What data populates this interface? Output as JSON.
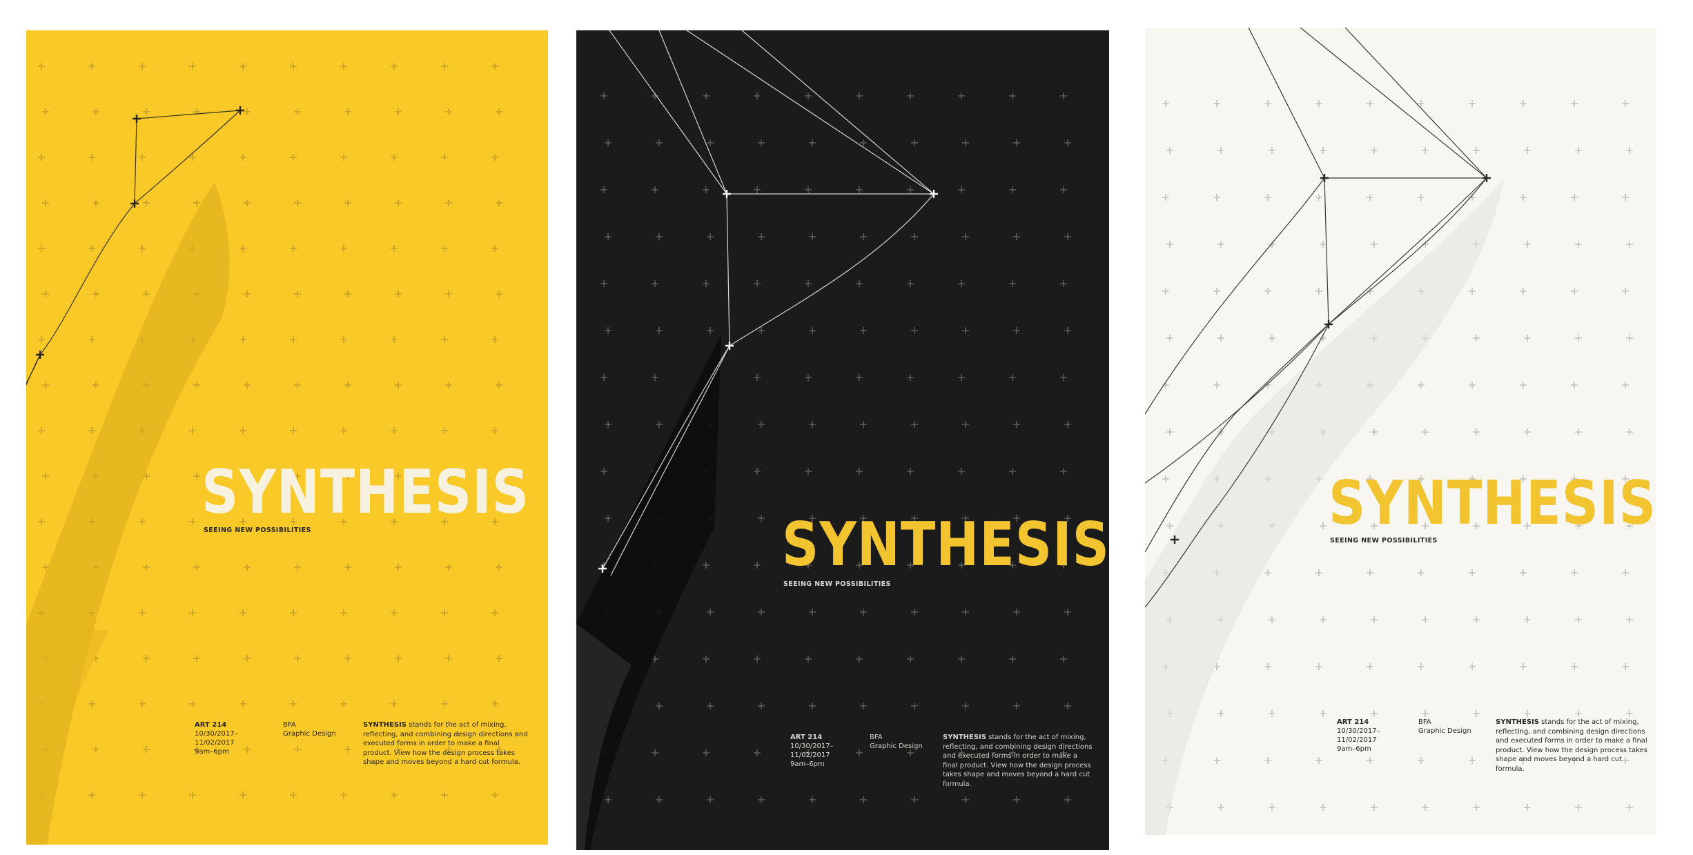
{
  "posters": [
    {
      "title": "SYNTHESIS",
      "subtitle": "SEEING NEW POSSIBILITIES",
      "course": "ART 214",
      "date_start": "10/30/2017–",
      "date_end": "11/02/2017",
      "hours": "9am–6pm",
      "program": "BFA",
      "department": "Graphic Design",
      "desc_lead": "SYNTHESIS",
      "desc_body": " stands for the act of mixing, reflecting, and combining design directions and executed forms in order to make a final product. View how the design process takes shape and moves beyond a hard cut formula."
    },
    {
      "title": "SYNTHESIS",
      "subtitle": "SEEING NEW POSSIBILITIES",
      "course": "ART 214",
      "date_start": "10/30/2017–",
      "date_end": "11/02/2017",
      "hours": "9am–6pm",
      "program": "BFA",
      "department": "Graphic Design",
      "desc_lead": "SYNTHESIS",
      "desc_body": " stands for the act of mixing, reflecting, and combining design directions and executed forms in order to make a final product. View how the design process takes shape and moves beyond a hard cut formula."
    },
    {
      "title": "SYNTHESIS",
      "subtitle": "SEEING NEW POSSIBILITIES",
      "course": "ART 214",
      "date_start": "10/30/2017–",
      "date_end": "11/02/2017",
      "hours": "9am–6pm",
      "program": "BFA",
      "department": "Graphic Design",
      "desc_lead": "SYNTHESIS",
      "desc_body": " stands for the act of mixing, reflecting, and combining design directions and executed forms in order to make a final product. View how the design process takes shape and moves beyond a hard cut formula."
    }
  ],
  "colors": {
    "yellow": "#f9c928",
    "black": "#1c1b1b",
    "cream": "#f7f6f1",
    "white": "#ffffff"
  }
}
